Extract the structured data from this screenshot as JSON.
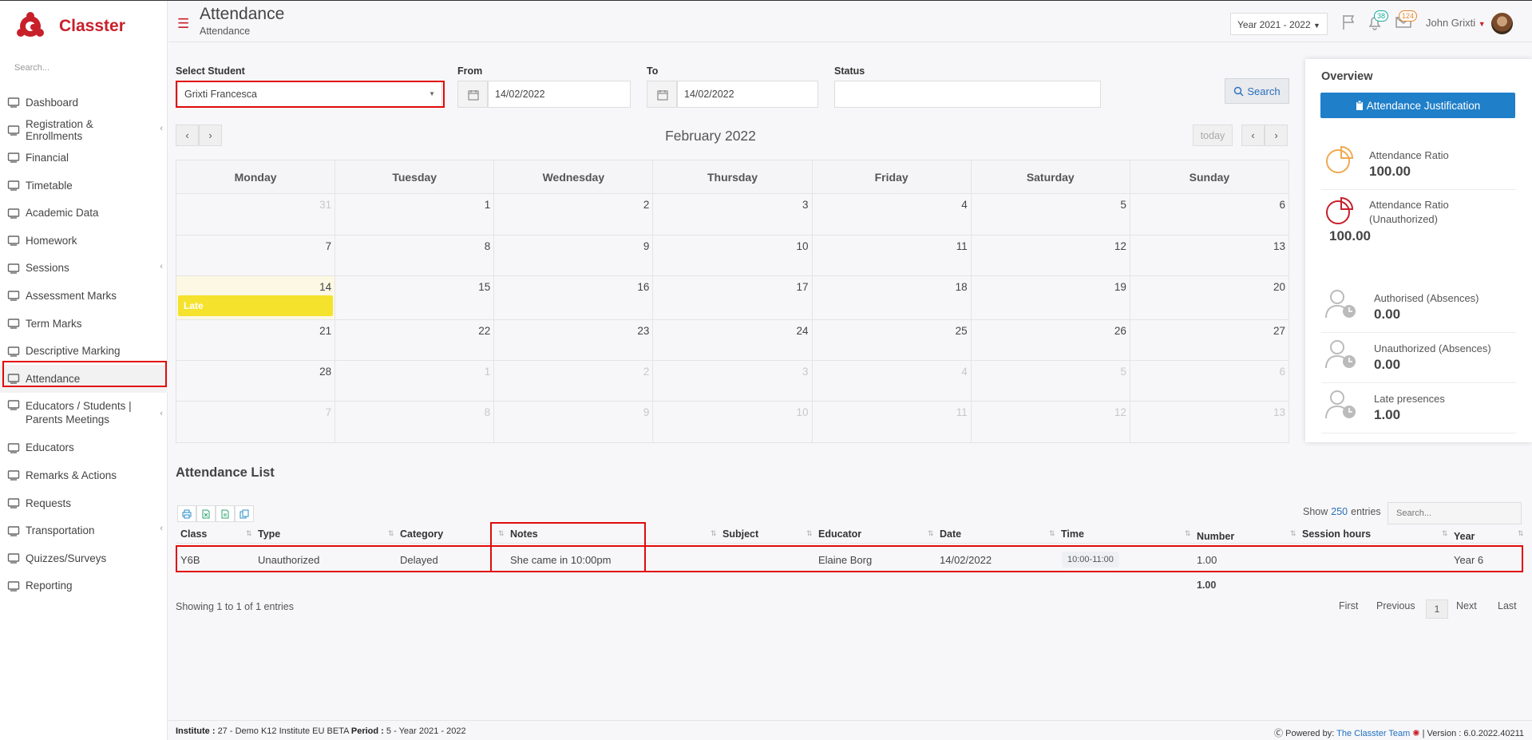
{
  "app": {
    "name": "Classter",
    "brand_color": "#c8202a"
  },
  "sidebar": {
    "search_placeholder": "Search...",
    "items": [
      {
        "label": "Dashboard",
        "icon": "monitor-icon"
      },
      {
        "label": "Registration & Enrollments",
        "icon": "bank-icon",
        "expandable": true
      },
      {
        "label": "Financial",
        "icon": "coins-icon"
      },
      {
        "label": "Timetable",
        "icon": "calendar-icon"
      },
      {
        "label": "Academic Data",
        "icon": "user-card-icon"
      },
      {
        "label": "Homework",
        "icon": "list-icon"
      },
      {
        "label": "Sessions",
        "icon": "presentation-icon",
        "expandable": true
      },
      {
        "label": "Assessment Marks",
        "icon": "edit-icon"
      },
      {
        "label": "Term Marks",
        "icon": "book-icon"
      },
      {
        "label": "Descriptive Marking",
        "icon": "pencil-icon"
      },
      {
        "label": "Attendance",
        "icon": "user-clock-icon",
        "active": true
      },
      {
        "label": "Educators / Students | Parents Meetings",
        "icon": "users-clock-icon",
        "expandable": true
      },
      {
        "label": "Educators",
        "icon": "users-icon"
      },
      {
        "label": "Remarks & Actions",
        "icon": "shuffle-icon"
      },
      {
        "label": "Requests",
        "icon": "document-icon"
      },
      {
        "label": "Transportation",
        "icon": "bus-icon",
        "expandable": true
      },
      {
        "label": "Quizzes/Surveys",
        "icon": "checklist-icon"
      },
      {
        "label": "Reporting",
        "icon": "printer-icon"
      }
    ]
  },
  "header": {
    "title": "Attendance",
    "breadcrumb": "Attendance",
    "year_selector": "Year 2021 - 2022",
    "notifications_count": "38",
    "messages_count": "124",
    "user_name": "John Grixti"
  },
  "filters": {
    "student_label": "Select Student",
    "student_value": "Grixti Francesca",
    "from_label": "From",
    "from_value": "14/02/2022",
    "to_label": "To",
    "to_value": "14/02/2022",
    "status_label": "Status",
    "status_value": "",
    "search_button": "Search"
  },
  "calendar": {
    "title": "February 2022",
    "today_label": "today",
    "weekdays": [
      "Monday",
      "Tuesday",
      "Wednesday",
      "Thursday",
      "Friday",
      "Saturday",
      "Sunday"
    ],
    "weeks": [
      [
        "31",
        "1",
        "2",
        "3",
        "4",
        "5",
        "6"
      ],
      [
        "7",
        "8",
        "9",
        "10",
        "11",
        "12",
        "13"
      ],
      [
        "14",
        "15",
        "16",
        "17",
        "18",
        "19",
        "20"
      ],
      [
        "21",
        "22",
        "23",
        "24",
        "25",
        "26",
        "27"
      ],
      [
        "28",
        "1",
        "2",
        "3",
        "4",
        "5",
        "6"
      ],
      [
        "7",
        "8",
        "9",
        "10",
        "11",
        "12",
        "13"
      ]
    ],
    "event": {
      "label": "Late",
      "color": "#f5e22c"
    }
  },
  "overview": {
    "title": "Overview",
    "justification_button": "Attendance Justification",
    "stats": [
      {
        "label": "Attendance Ratio",
        "value": "100.00"
      },
      {
        "label": "Attendance Ratio (Unauthorized)",
        "value": "100.00"
      },
      {
        "label": "Authorised (Absences)",
        "value": "0.00"
      },
      {
        "label": "Unauthorized (Absences)",
        "value": "0.00"
      },
      {
        "label": "Late presences",
        "value": "1.00"
      }
    ]
  },
  "list": {
    "title": "Attendance List",
    "show_label": "Show",
    "show_count": "250",
    "entries_label": "entries",
    "search_placeholder": "Search...",
    "columns": [
      "Class",
      "Type",
      "Category",
      "Notes",
      "Subject",
      "Educator",
      "Date",
      "Time",
      "Number",
      "Session hours",
      "Year"
    ],
    "rows": [
      {
        "class": "Y6B",
        "type": "Unauthorized",
        "category": "Delayed",
        "notes": "She came in 10:00pm",
        "subject": "",
        "educator": "Elaine Borg",
        "date": "14/02/2022",
        "time": "10:00-11:00",
        "number": "1.00",
        "session_hours": "",
        "year": "Year 6"
      }
    ],
    "total_number": "1.00",
    "showing_text": "Showing 1 to 1 of 1 entries",
    "pagination": {
      "first": "First",
      "previous": "Previous",
      "current": "1",
      "next": "Next",
      "last": "Last"
    }
  },
  "footer": {
    "institute_label": "Institute :",
    "institute_value": "27 - Demo K12 Institute EU BETA",
    "period_label": "Period :",
    "period_value": "5 - Year 2021 - 2022",
    "powered_by": "Powered by:",
    "team": "The Classter Team",
    "version": "| Version : 6.0.2022.40211"
  }
}
